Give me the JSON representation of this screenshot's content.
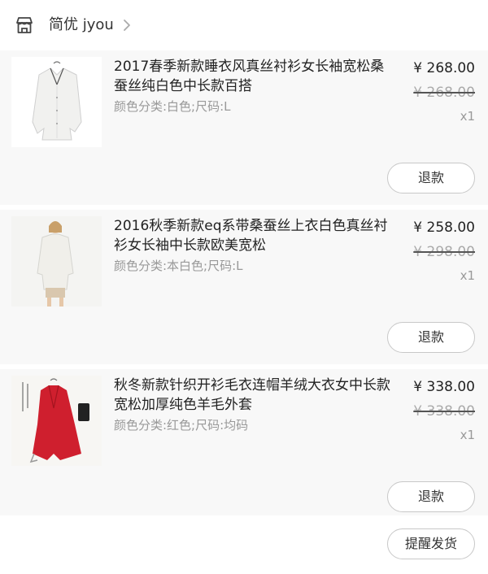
{
  "shop": {
    "name": "简优 jyou",
    "icon": "store-icon"
  },
  "items": [
    {
      "title": "2017春季新款睡衣风真丝衬衫女长袖宽松桑蚕丝纯白色中长款百搭",
      "spec": "颜色分类:白色;尺码:L",
      "price": "¥ 268.00",
      "original_price": "¥ 268.00",
      "quantity": "x1",
      "refund_label": "退款"
    },
    {
      "title": "2016秋季新款eq系带桑蚕丝上衣白色真丝衬衫女长袖中长款欧美宽松",
      "spec": "颜色分类:本白色;尺码:L",
      "price": "¥ 258.00",
      "original_price": "¥ 298.00",
      "quantity": "x1",
      "refund_label": "退款"
    },
    {
      "title": "秋冬新款针织开衫毛衣连帽羊绒大衣女中长款宽松加厚纯色羊毛外套",
      "spec": "颜色分类:红色;尺码:均码",
      "price": "¥ 338.00",
      "original_price": "¥ 338.00",
      "quantity": "x1",
      "refund_label": "退款"
    }
  ],
  "footer": {
    "remind_label": "提醒发货"
  }
}
